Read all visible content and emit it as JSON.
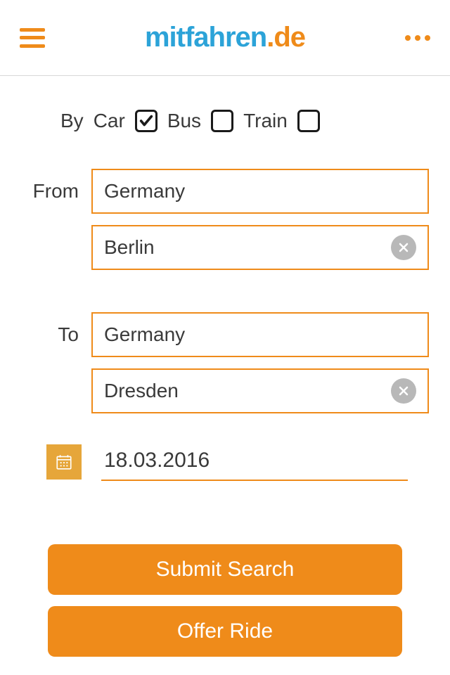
{
  "header": {
    "logo_part1": "mitfahren",
    "logo_part2": ".de"
  },
  "form": {
    "by_label": "By",
    "transport": {
      "car": {
        "label": "Car",
        "checked": true
      },
      "bus": {
        "label": "Bus",
        "checked": false
      },
      "train": {
        "label": "Train",
        "checked": false
      }
    },
    "from_label": "From",
    "from_country": "Germany",
    "from_city": "Berlin",
    "to_label": "To",
    "to_country": "Germany",
    "to_city": "Dresden",
    "date": "18.03.2016"
  },
  "buttons": {
    "submit": "Submit Search",
    "offer": "Offer Ride"
  }
}
